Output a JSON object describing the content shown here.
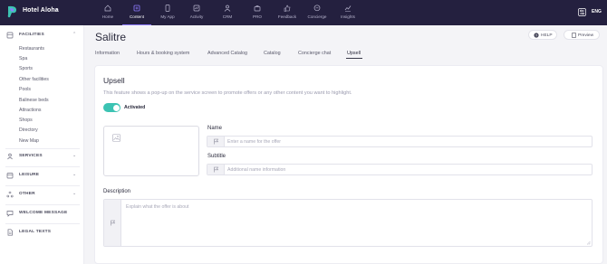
{
  "hotel": {
    "name": "Hotel Aloha"
  },
  "nav": {
    "items": [
      {
        "label": "Home",
        "icon": "home-icon"
      },
      {
        "label": "Content",
        "icon": "content-icon",
        "active": true
      },
      {
        "label": "My App",
        "icon": "phone-icon"
      },
      {
        "label": "Activity",
        "icon": "activity-icon"
      },
      {
        "label": "CRM",
        "icon": "people-icon"
      },
      {
        "label": "PRO",
        "icon": "bag-icon"
      },
      {
        "label": "Feedback",
        "icon": "thumb-icon"
      },
      {
        "label": "Concierge",
        "icon": "chat-icon"
      },
      {
        "label": "Insights",
        "icon": "chart-icon"
      }
    ],
    "language": "ENG"
  },
  "sidebar": {
    "facilities": {
      "label": "FACILITIES",
      "items": [
        "Restaurants",
        "Spa",
        "Sports",
        "Other facilities",
        "Pools",
        "Balinese beds",
        "Attractions",
        "Shops",
        "Directory",
        "New Map"
      ]
    },
    "services": {
      "label": "SERVICES"
    },
    "leisure": {
      "label": "LEISURE"
    },
    "other": {
      "label": "OTHER"
    },
    "welcome": {
      "label": "WELCOME MESSAGE"
    },
    "legal": {
      "label": "LEGAL TEXTS"
    }
  },
  "header": {
    "title": "Salitre",
    "help_label": "HELP",
    "preview_label": "Preview"
  },
  "tabs": [
    "Information",
    "Hours & booking system",
    "Advanced Catalog",
    "Catalog",
    "Concierge chat",
    "Upsell"
  ],
  "active_tab": "Upsell",
  "upsell": {
    "title": "Upsell",
    "description": "This feature shows a pop-up on the service screen to promote offers or any other content you want to highlight.",
    "toggle_label": "Activated",
    "toggle_on": true,
    "name_label": "Name",
    "name_placeholder": "Enter a name for the offer",
    "name_value": "",
    "subtitle_label": "Subtitle",
    "subtitle_placeholder": "Additional name information",
    "subtitle_value": "",
    "description_label": "Description",
    "description_placeholder": "Explain what the offer is about",
    "description_value": ""
  },
  "colors": {
    "topbar": "#24203f",
    "accent_toggle": "#3cc3b3",
    "nav_active_underline": "#8f7cff"
  }
}
